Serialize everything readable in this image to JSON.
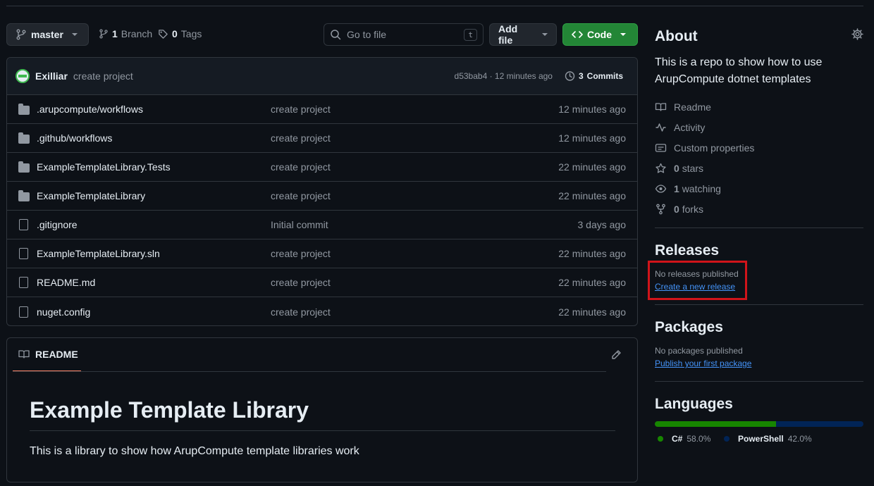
{
  "toolbar": {
    "branch": "master",
    "branch_count": "1",
    "branch_label": "Branch",
    "tag_count": "0",
    "tag_label": "Tags",
    "search_placeholder": "Go to file",
    "search_shortcut": "t",
    "add_file_label": "Add file",
    "code_label": "Code"
  },
  "commit": {
    "author": "Exilliar",
    "message": "create project",
    "meta": "d53bab4 · 12 minutes ago",
    "commits_count": "3",
    "commits_label": "Commits"
  },
  "files": [
    {
      "type": "folder",
      "name": ".arupcompute/workflows",
      "message": "create project",
      "time": "12 minutes ago"
    },
    {
      "type": "folder",
      "name": ".github/workflows",
      "message": "create project",
      "time": "12 minutes ago"
    },
    {
      "type": "folder",
      "name": "ExampleTemplateLibrary.Tests",
      "message": "create project",
      "time": "22 minutes ago"
    },
    {
      "type": "folder",
      "name": "ExampleTemplateLibrary",
      "message": "create project",
      "time": "22 minutes ago"
    },
    {
      "type": "file",
      "name": ".gitignore",
      "message": "Initial commit",
      "time": "3 days ago"
    },
    {
      "type": "file",
      "name": "ExampleTemplateLibrary.sln",
      "message": "create project",
      "time": "22 minutes ago"
    },
    {
      "type": "file",
      "name": "README.md",
      "message": "create project",
      "time": "22 minutes ago"
    },
    {
      "type": "file",
      "name": "nuget.config",
      "message": "create project",
      "time": "22 minutes ago"
    }
  ],
  "readme": {
    "tab_label": "README",
    "heading": "Example Template Library",
    "body": "This is a library to show how ArupCompute template libraries work"
  },
  "about": {
    "title": "About",
    "description": "This is a repo to show how to use ArupCompute dotnet templates",
    "readme": "Readme",
    "activity": "Activity",
    "custom_properties": "Custom properties",
    "stars_count": "0",
    "stars_label": "stars",
    "watching_count": "1",
    "watching_label": "watching",
    "forks_count": "0",
    "forks_label": "forks"
  },
  "releases": {
    "title": "Releases",
    "none": "No releases published",
    "create_link": "Create a new release"
  },
  "packages": {
    "title": "Packages",
    "none": "No packages published",
    "publish_link": "Publish your first package"
  },
  "languages": {
    "title": "Languages",
    "items": [
      {
        "name": "C#",
        "percent": "58.0%",
        "value": 58.0,
        "color": "#178600"
      },
      {
        "name": "PowerShell",
        "percent": "42.0%",
        "value": 42.0,
        "color": "#012456"
      }
    ]
  },
  "colors": {
    "accent_green": "#238636",
    "link_blue": "#4493f8",
    "highlight_red": "#d0141a",
    "tab_underline": "#f78166"
  }
}
